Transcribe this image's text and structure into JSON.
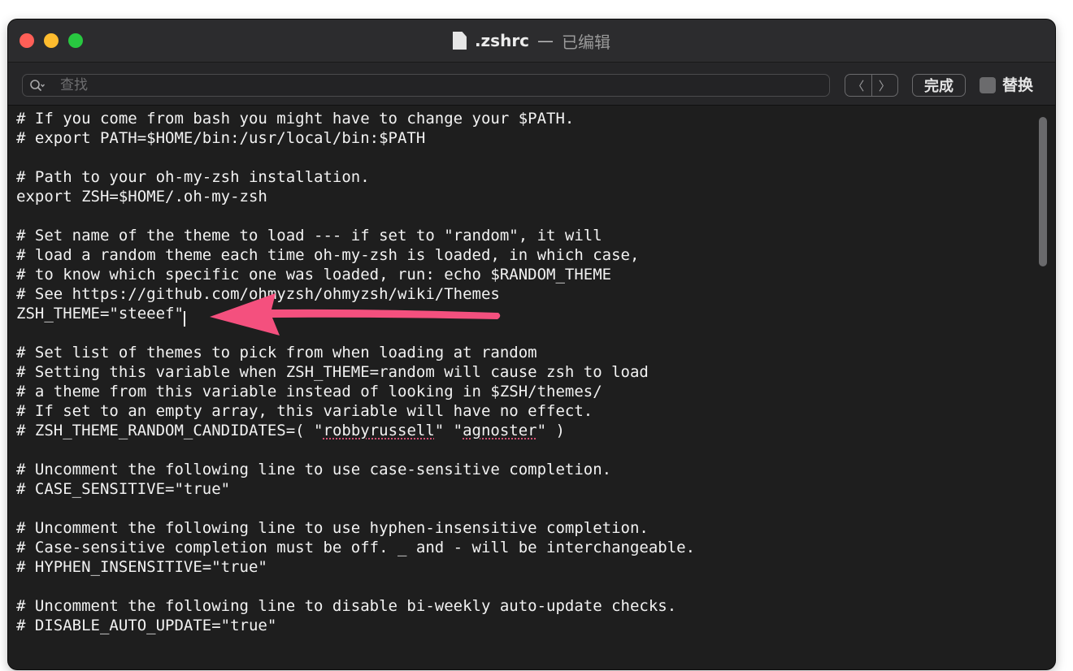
{
  "window": {
    "title": ".zshrc",
    "separator": "—",
    "status": "已编辑"
  },
  "find_bar": {
    "search_placeholder": "查找",
    "search_value": "",
    "prev_symbol": "〈",
    "next_symbol": "〉",
    "done_label": "完成",
    "replace_label": "替换",
    "replace_checked": false
  },
  "editor": {
    "lines": [
      "# If you come from bash you might have to change your $PATH.",
      "# export PATH=$HOME/bin:/usr/local/bin:$PATH",
      "",
      "# Path to your oh-my-zsh installation.",
      "export ZSH=$HOME/.oh-my-zsh",
      "",
      "# Set name of the theme to load --- if set to \"random\", it will",
      "# load a random theme each time oh-my-zsh is loaded, in which case,",
      "# to know which specific one was loaded, run: echo $RANDOM_THEME",
      "# See https://github.com/ohmyzsh/ohmyzsh/wiki/Themes",
      "ZSH_THEME=\"steeef\"",
      "",
      "# Set list of themes to pick from when loading at random",
      "# Setting this variable when ZSH_THEME=random will cause zsh to load",
      "# a theme from this variable instead of looking in $ZSH/themes/",
      "# If set to an empty array, this variable will have no effect.",
      "# ZSH_THEME_RANDOM_CANDIDATES=( \"robbyrussell\" \"agnoster\" )",
      "",
      "# Uncomment the following line to use case-sensitive completion.",
      "# CASE_SENSITIVE=\"true\"",
      "",
      "# Uncomment the following line to use hyphen-insensitive completion.",
      "# Case-sensitive completion must be off. _ and - will be interchangeable.",
      "# HYPHEN_INSENSITIVE=\"true\"",
      "",
      "# Uncomment the following line to disable bi-weekly auto-update checks.",
      "# DISABLE_AUTO_UPDATE=\"true\"",
      ""
    ],
    "candidates_line": {
      "prefix": "# ZSH_THEME_RANDOM_CANDIDATES=( \"",
      "word1": "robbyrussell",
      "middle": "\" \"",
      "word2": "agnoster",
      "suffix": "\" )"
    }
  },
  "colors": {
    "editor_background": "#1e1e1e",
    "text": "#f2f2f2",
    "annotation_arrow": "#f4507e",
    "spellcheck_underline": "#e0567a"
  },
  "annotation": {
    "type": "arrow",
    "target_line_index": 10,
    "icon": "arrow-left-icon"
  }
}
